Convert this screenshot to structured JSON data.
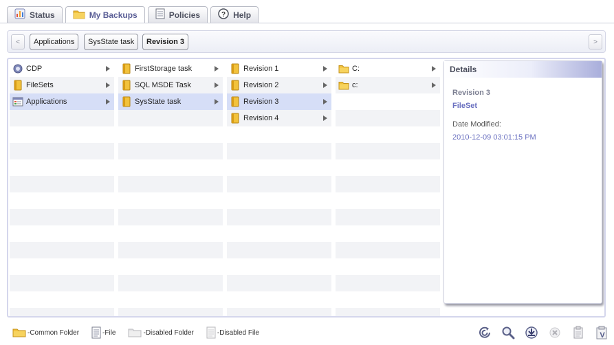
{
  "tabs": [
    {
      "label": "Status"
    },
    {
      "label": "My Backups"
    },
    {
      "label": "Policies"
    },
    {
      "label": "Help"
    }
  ],
  "breadcrumb": {
    "back_glyph": "<",
    "forward_glyph": ">",
    "items": [
      "Applications",
      "SysState task",
      "Revision 3"
    ]
  },
  "columns": [
    {
      "items": [
        {
          "label": "CDP",
          "icon": "cdp-icon"
        },
        {
          "label": "FileSets",
          "icon": "folder-icon"
        },
        {
          "label": "Applications",
          "icon": "applications-icon",
          "selected": true
        }
      ]
    },
    {
      "items": [
        {
          "label": "FirstStorage task",
          "icon": "folder-icon"
        },
        {
          "label": "SQL MSDE Task",
          "icon": "folder-icon"
        },
        {
          "label": "SysState task",
          "icon": "folder-icon",
          "selected": true
        }
      ]
    },
    {
      "items": [
        {
          "label": "Revision 1",
          "icon": "folder-icon"
        },
        {
          "label": "Revision 2",
          "icon": "folder-icon"
        },
        {
          "label": "Revision 3",
          "icon": "folder-icon",
          "selected": true
        },
        {
          "label": "Revision 4",
          "icon": "folder-icon"
        }
      ]
    },
    {
      "items": [
        {
          "label": "C:",
          "icon": "common-folder-icon"
        },
        {
          "label": "c:",
          "icon": "common-folder-icon"
        }
      ]
    }
  ],
  "details": {
    "title": "Details",
    "name": "Revision 3",
    "type": "FileSet",
    "date_label": "Date Modified:",
    "date_value": "2010-12-09 03:01:15 PM"
  },
  "legend": {
    "common_folder": "-Common Folder",
    "file": "-File",
    "disabled_folder": "-Disabled Folder",
    "disabled_file": "-Disabled File"
  },
  "toolbar_icons": [
    "restore-icon",
    "search-icon",
    "download-icon",
    "delete-icon",
    "copy-icon",
    "verify-icon"
  ],
  "colors": {
    "selection": "#d6def7",
    "accent": "#6a70c0",
    "folder": "#f2c23c"
  }
}
